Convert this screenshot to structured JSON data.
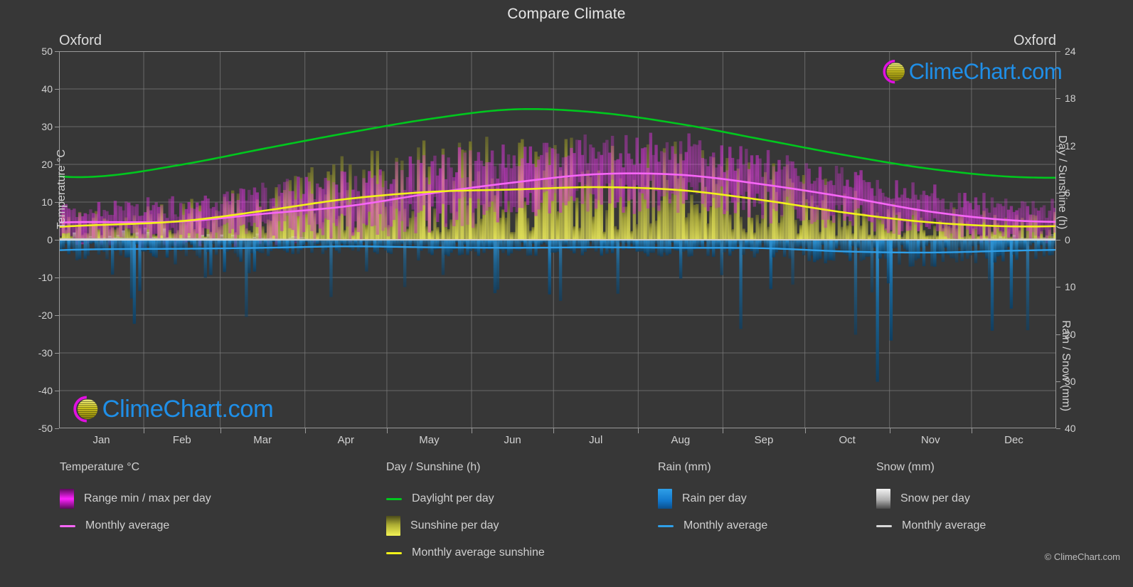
{
  "header": {
    "title": "Compare Climate",
    "city_left": "Oxford",
    "city_right": "Oxford"
  },
  "axes": {
    "left_title": "Temperature °C",
    "right_top_title": "Day / Sunshine (h)",
    "right_bottom_title": "Rain / Snow (mm)",
    "temp_ticks": [
      "50",
      "40",
      "30",
      "20",
      "10",
      "0",
      "-10",
      "-20",
      "-30",
      "-40",
      "-50"
    ],
    "day_ticks": [
      "24",
      "18",
      "12",
      "6",
      "0"
    ],
    "rain_ticks": [
      "0",
      "10",
      "20",
      "30",
      "40"
    ],
    "months": [
      "Jan",
      "Feb",
      "Mar",
      "Apr",
      "May",
      "Jun",
      "Jul",
      "Aug",
      "Sep",
      "Oct",
      "Nov",
      "Dec"
    ]
  },
  "legend": {
    "temperature": {
      "heading": "Temperature °C",
      "range_label": "Range min / max per day",
      "avg_label": "Monthly average"
    },
    "daylight": {
      "heading": "Day / Sunshine (h)",
      "daylight_label": "Daylight per day",
      "sunshine_label": "Sunshine per day",
      "avg_label": "Monthly average sunshine"
    },
    "rain": {
      "heading": "Rain (mm)",
      "per_day_label": "Rain per day",
      "avg_label": "Monthly average"
    },
    "snow": {
      "heading": "Snow (mm)",
      "per_day_label": "Snow per day",
      "avg_label": "Monthly average"
    }
  },
  "branding": {
    "logo_text": "ClimeChart.com",
    "copyright": "© ClimeChart.com"
  },
  "colors": {
    "background": "#373737",
    "grid": "#7a7a7a",
    "frame": "#9a9a9a",
    "temp_range": "#e633e6",
    "temp_avg": "#f766f7",
    "daylight": "#00c71e",
    "sunshine": "#d9d84a",
    "sunshine_avg": "#f2f21a",
    "rain": "#1287d8",
    "rain_avg": "#2f9fe8",
    "snow": "#d8d8d8",
    "snow_avg": "#cccccc",
    "logo_text": "#1f8fe8",
    "logo_arc": "#e010e0",
    "logo_sphere": "#d8d018"
  },
  "chart_data": {
    "type": "area",
    "title": "Compare Climate",
    "xlabel": "",
    "categories": [
      "Jan",
      "Feb",
      "Mar",
      "Apr",
      "May",
      "Jun",
      "Jul",
      "Aug",
      "Sep",
      "Oct",
      "Nov",
      "Dec"
    ],
    "axis_left": {
      "label": "Temperature °C",
      "min": -50,
      "max": 50,
      "step": 10
    },
    "axis_right_top": {
      "label": "Day / Sunshine (h)",
      "min": 0,
      "max": 24,
      "step": 6
    },
    "axis_right_bottom": {
      "label": "Rain / Snow (mm)",
      "min": 0,
      "max": 40,
      "step": 10,
      "inverted": true
    },
    "grid": true,
    "legend_position": "bottom",
    "series": [
      {
        "name": "Daylight per day",
        "unit": "h",
        "axis": "right_top",
        "color": "#00c71e",
        "values": [
          8.1,
          9.6,
          11.6,
          13.6,
          15.4,
          16.6,
          16.2,
          14.7,
          12.7,
          10.7,
          9.0,
          8.0
        ]
      },
      {
        "name": "Monthly average sunshine",
        "unit": "h",
        "axis": "right_top",
        "color": "#f2f21a",
        "values": [
          1.9,
          2.4,
          3.7,
          5.2,
          6.1,
          6.4,
          6.7,
          6.3,
          5.0,
          3.4,
          2.2,
          1.7
        ]
      },
      {
        "name": "Monthly average temperature",
        "unit": "°C",
        "axis": "left",
        "color": "#f766f7",
        "values": [
          4.7,
          4.9,
          6.9,
          8.9,
          12.3,
          15.2,
          17.4,
          17.2,
          14.6,
          11.2,
          7.4,
          5.1
        ]
      },
      {
        "name": "Temperature range min per day",
        "unit": "°C",
        "axis": "left",
        "color": "#e633e6",
        "values": [
          1.5,
          1.4,
          2.8,
          4.1,
          7.0,
          10.0,
          12.2,
          12.1,
          9.8,
          7.1,
          3.9,
          2.0
        ]
      },
      {
        "name": "Temperature range max per day",
        "unit": "°C",
        "axis": "left",
        "color": "#e633e6",
        "values": [
          7.9,
          8.4,
          11.0,
          13.7,
          17.6,
          20.4,
          22.6,
          22.3,
          19.4,
          15.3,
          11.0,
          8.3
        ]
      },
      {
        "name": "Monthly average rain",
        "unit": "mm",
        "axis": "right_bottom",
        "color": "#2f9fe8",
        "values": [
          2.0,
          1.9,
          1.7,
          1.4,
          1.6,
          1.7,
          1.6,
          1.7,
          1.8,
          2.5,
          2.7,
          2.3
        ]
      },
      {
        "name": "Monthly average snow",
        "unit": "mm",
        "axis": "right_bottom",
        "color": "#cccccc",
        "values": [
          0.1,
          0.1,
          0.05,
          0.0,
          0.0,
          0.0,
          0.0,
          0.0,
          0.0,
          0.0,
          0.0,
          0.05
        ]
      }
    ]
  }
}
